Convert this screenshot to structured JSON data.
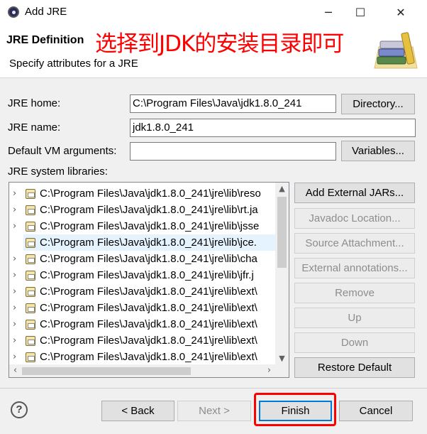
{
  "window": {
    "title": "Add JRE",
    "minimize_icon": "minimize-icon",
    "maximize_icon": "maximize-icon",
    "close_icon": "close-icon"
  },
  "header": {
    "title": "JRE Definition",
    "annotation": "选择到JDK的安装目录即可",
    "description": "Specify attributes for a JRE",
    "banner_icon": "books-jre-icon",
    "annotation_color": "#ff0000"
  },
  "form": {
    "jre_home_label": "JRE home:",
    "jre_home_value": "C:\\Program Files\\Java\\jdk1.8.0_241",
    "directory_button": "Directory...",
    "jre_name_label": "JRE name:",
    "jre_name_value": "jdk1.8.0_241",
    "vm_args_label": "Default VM arguments:",
    "vm_args_value": "",
    "variables_button": "Variables...",
    "libraries_label": "JRE system libraries:"
  },
  "libraries": [
    "C:\\Program Files\\Java\\jdk1.8.0_241\\jre\\lib\\reso",
    "C:\\Program Files\\Java\\jdk1.8.0_241\\jre\\lib\\rt.ja",
    "C:\\Program Files\\Java\\jdk1.8.0_241\\jre\\lib\\jsse",
    "C:\\Program Files\\Java\\jdk1.8.0_241\\jre\\lib\\jce.",
    "C:\\Program Files\\Java\\jdk1.8.0_241\\jre\\lib\\cha",
    "C:\\Program Files\\Java\\jdk1.8.0_241\\jre\\lib\\jfr.j",
    "C:\\Program Files\\Java\\jdk1.8.0_241\\jre\\lib\\ext\\",
    "C:\\Program Files\\Java\\jdk1.8.0_241\\jre\\lib\\ext\\",
    "C:\\Program Files\\Java\\jdk1.8.0_241\\jre\\lib\\ext\\",
    "C:\\Program Files\\Java\\jdk1.8.0_241\\jre\\lib\\ext\\",
    "C:\\Program Files\\Java\\jdk1.8.0_241\\jre\\lib\\ext\\"
  ],
  "selected_library_index": 3,
  "side_buttons": {
    "add_external_jars": "Add External JARs...",
    "javadoc_location": "Javadoc Location...",
    "source_attachment": "Source Attachment...",
    "external_annotations": "External annotations...",
    "remove": "Remove",
    "up": "Up",
    "down": "Down",
    "restore_default": "Restore Default"
  },
  "footer": {
    "help_icon": "help-icon",
    "back": "< Back",
    "next": "Next >",
    "finish": "Finish",
    "cancel": "Cancel",
    "finish_highlight_color": "#ff0000"
  }
}
